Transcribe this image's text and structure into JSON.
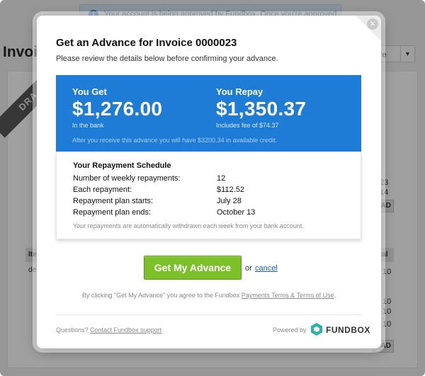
{
  "background": {
    "banner_text": "Your account is being approved by Fundbox. Once you're approved",
    "banner_icon": "info-icon",
    "page_title": "Invoic",
    "more_button": "ore",
    "draft_ribbon": "DRA",
    "side_values": [
      "23",
      "14"
    ],
    "side_button": "AD",
    "table_headers": [
      "Ite",
      "tal"
    ],
    "table_cell": "de",
    "lower_buttons": [
      "AD"
    ],
    "lower_values": [
      "10",
      "10",
      "10",
      "10"
    ]
  },
  "modal": {
    "title": "Get an Advance for Invoice 0000023",
    "subtitle": "Please review the details below before confirming your advance.",
    "close_icon": "close-icon",
    "you_get": {
      "label": "You Get",
      "amount": "$1,276.00",
      "note": "In the bank"
    },
    "you_repay": {
      "label": "You Repay",
      "amount": "$1,350.37",
      "note": "Includes fee of $74.37"
    },
    "after_note": "After you receive this advance you will have $3200.34 in available credit.",
    "schedule": {
      "title": "Your Repayment Schedule",
      "rows": [
        {
          "label": "Number of weekly repayments:",
          "value": "12"
        },
        {
          "label": "Each repayment:",
          "value": "$112.52"
        },
        {
          "label": "Repayment plan starts:",
          "value": "July 28"
        },
        {
          "label": "Repayment plan ends:",
          "value": "October 13"
        }
      ],
      "footnote": "Your repayments are automatically withdrawn each week from your bank account."
    },
    "cta_label": "Get My Advance",
    "or_text": "or",
    "cancel_label": "cancel",
    "terms_prefix": "By clicking \"Get My Advance\" you agree to the Fundbox ",
    "terms_link": "Payments Terms & Terms of Use",
    "terms_suffix": ".",
    "questions_prefix": "Questions? ",
    "support_link": "Contact Fundbox support",
    "powered_by": "Powered by",
    "brand_name": "FUNDBOX",
    "colors": {
      "accent_blue": "#1e7bd6",
      "cta_green": "#7cc12a",
      "brand_teal": "#2bb3a6"
    }
  }
}
